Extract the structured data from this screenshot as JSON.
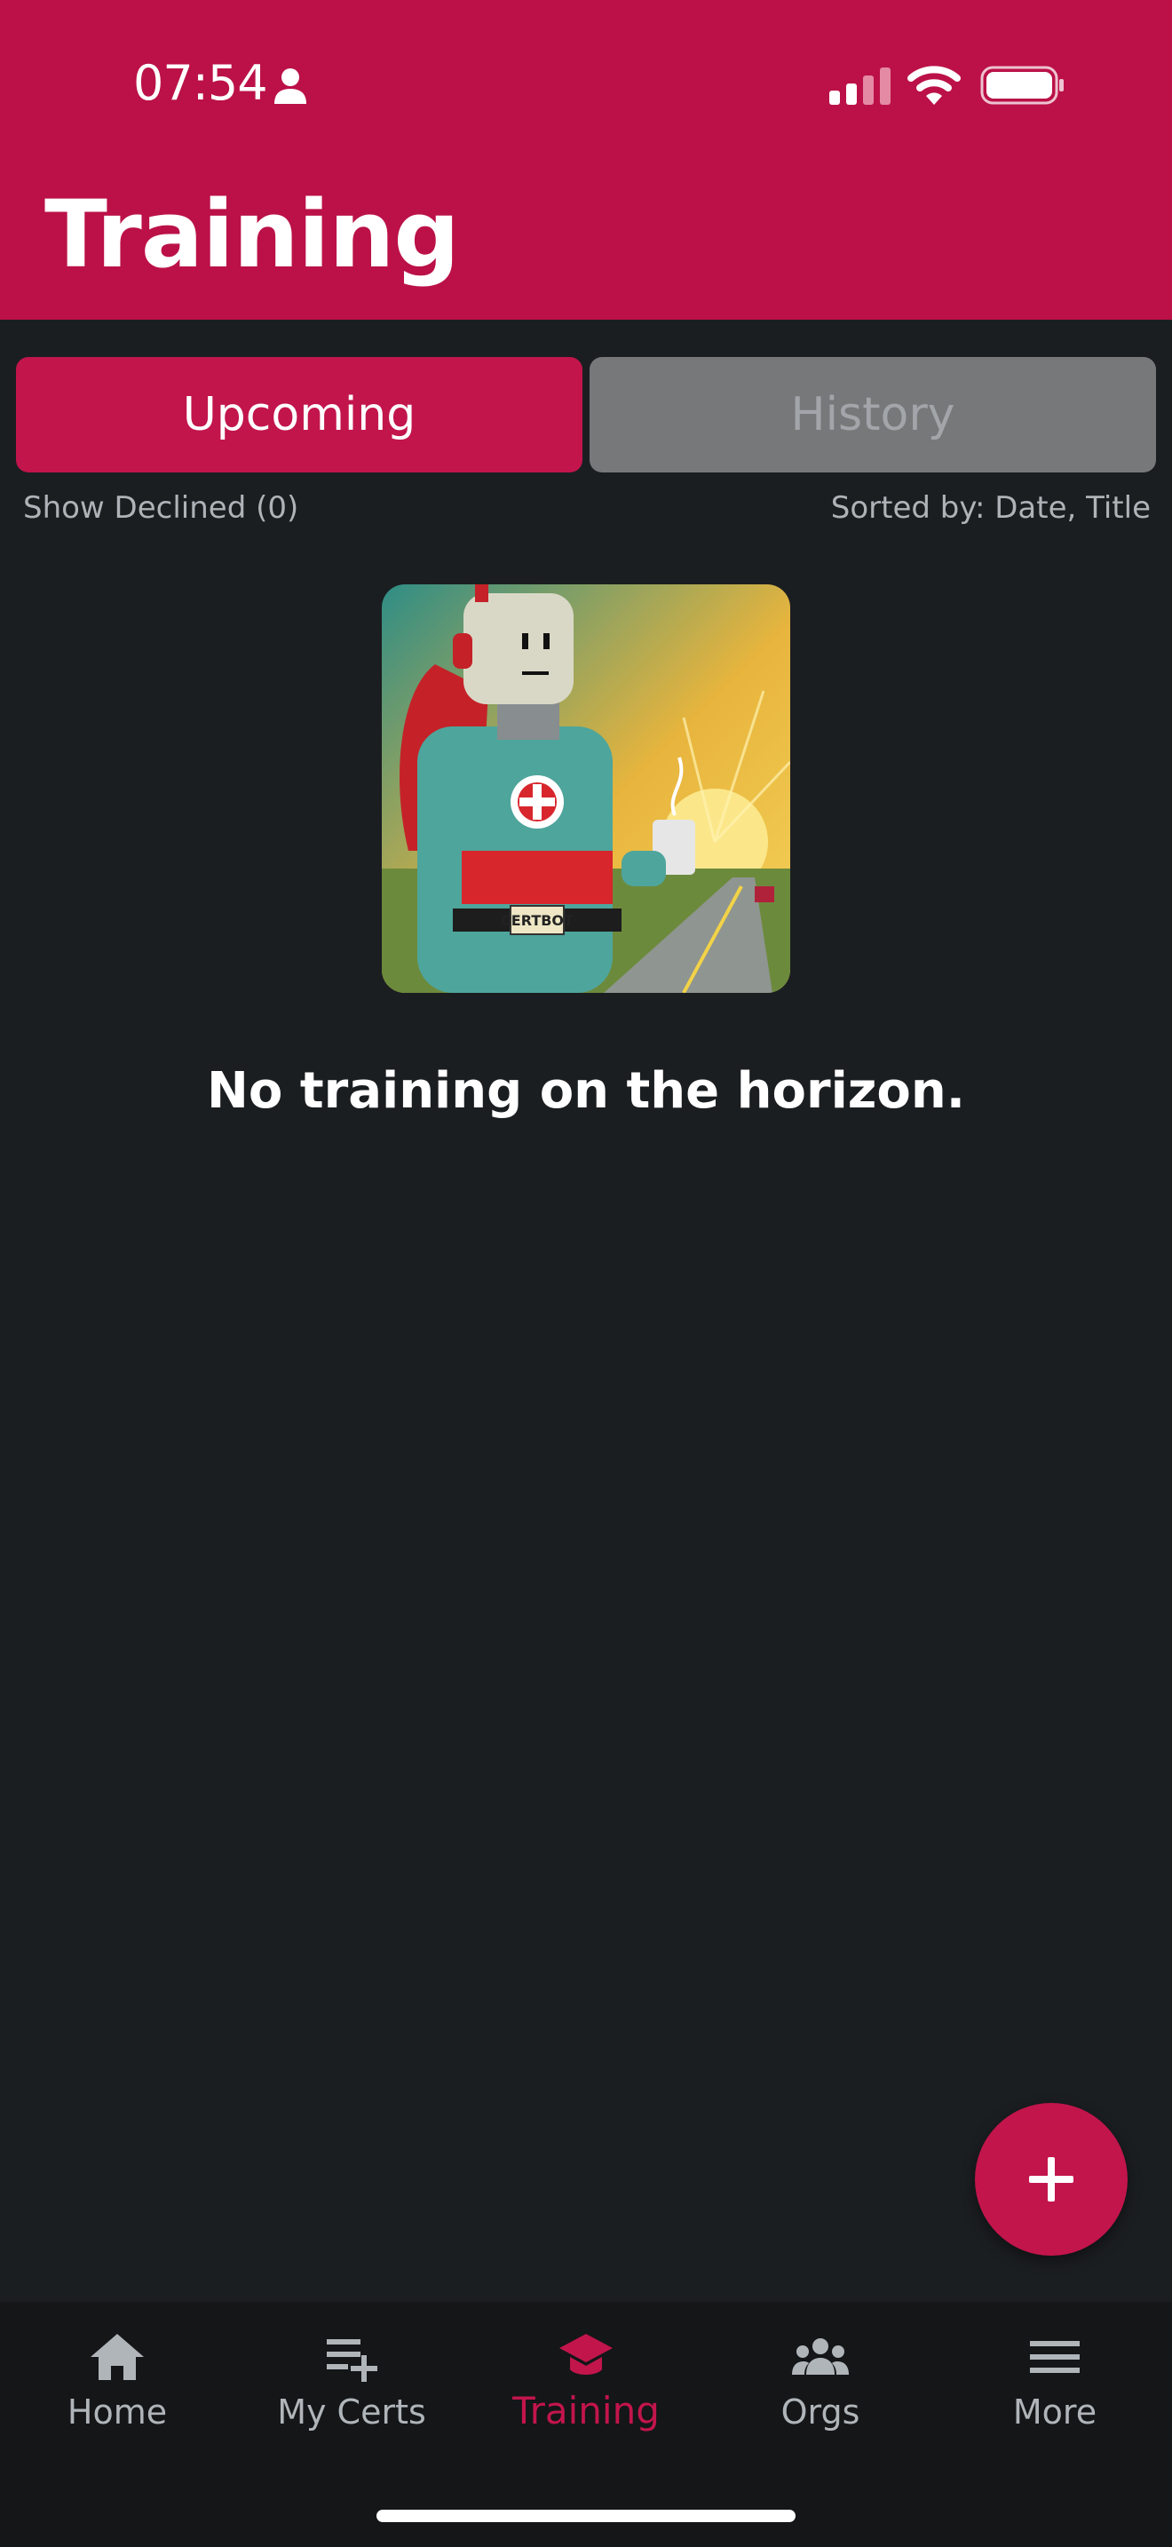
{
  "status_bar": {
    "time": "07:54"
  },
  "header": {
    "title": "Training"
  },
  "segments": {
    "upcoming": "Upcoming",
    "history": "History"
  },
  "filters": {
    "show_declined": "Show Declined  (0)",
    "sorted_by": "Sorted by: Date, Title"
  },
  "empty_state": {
    "message": "No training on the horizon.",
    "badge_text": "CERTBOT"
  },
  "tabs": [
    {
      "label": "Home",
      "icon": "home-icon"
    },
    {
      "label": "My Certs",
      "icon": "playlist-add-icon"
    },
    {
      "label": "Training",
      "icon": "graduation-cap-icon",
      "active": true
    },
    {
      "label": "Orgs",
      "icon": "group-icon"
    },
    {
      "label": "More",
      "icon": "menu-icon"
    }
  ],
  "colors": {
    "brand": "#bb1148",
    "accent": "#c2154c",
    "background": "#1b1e21",
    "tabbar": "#141618"
  }
}
